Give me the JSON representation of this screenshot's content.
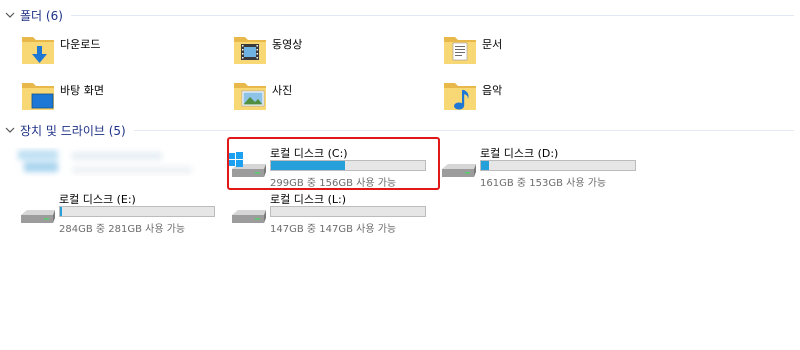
{
  "folders_group": {
    "title": "폴더 (6)"
  },
  "folders": [
    {
      "label": "다운로드",
      "icon": "downloads-folder-icon"
    },
    {
      "label": "동영상",
      "icon": "videos-folder-icon"
    },
    {
      "label": "문서",
      "icon": "documents-folder-icon"
    },
    {
      "label": "바탕 화면",
      "icon": "desktop-folder-icon"
    },
    {
      "label": "사진",
      "icon": "pictures-folder-icon"
    },
    {
      "label": "음악",
      "icon": "music-folder-icon"
    }
  ],
  "drives_group": {
    "title": "장치 및 드라이브 (5)"
  },
  "drives": [
    {
      "name": "로컬 디스크 (C:)",
      "free_text": "299GB 중 156GB 사용 가능",
      "used_fraction": 0.48,
      "icon": "windows-system-drive-icon"
    },
    {
      "name": "로컬 디스크 (D:)",
      "free_text": "161GB 중 153GB 사용 가능",
      "used_fraction": 0.05,
      "icon": "hard-drive-icon"
    },
    {
      "name": "로컬 디스크 (E:)",
      "free_text": "284GB 중 281GB 사용 가능",
      "used_fraction": 0.01,
      "icon": "hard-drive-icon"
    },
    {
      "name": "로컬 디스크 (L:)",
      "free_text": "147GB 중 147GB 사용 가능",
      "used_fraction": 0.0,
      "icon": "hard-drive-icon"
    }
  ],
  "colors": {
    "group_title": "#1e3287",
    "bar_fill": "#26a0da",
    "bar_bg": "#e6e6e6",
    "highlight": "#e01818"
  }
}
